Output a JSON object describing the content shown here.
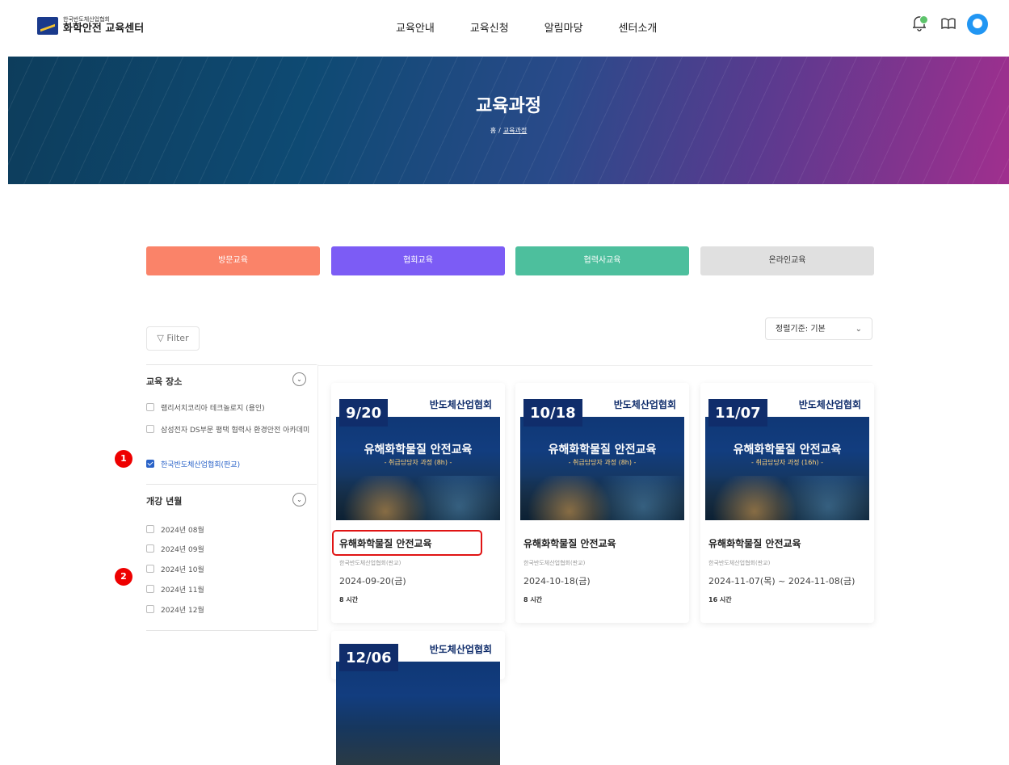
{
  "header": {
    "logo_small": "한국반도체산업협회",
    "logo_big": "화학안전 교육센터",
    "nav": [
      "교육안내",
      "교육신청",
      "알림마당",
      "센터소개"
    ]
  },
  "banner": {
    "title": "교육과정",
    "crumb_home": "홈",
    "crumb_current": "교육과정"
  },
  "categories": [
    {
      "label": "방문교육",
      "color": "#fa8369"
    },
    {
      "label": "협회교육",
      "color": "#7c5cf5"
    },
    {
      "label": "협력사교육",
      "color": "#4dbf9d"
    },
    {
      "label": "온라인교육",
      "color": "#e0e0e0"
    }
  ],
  "sort": {
    "label": "정렬기준:  기본"
  },
  "filter": {
    "label": "Filter"
  },
  "sidebar": {
    "location": {
      "title": "교육 장소",
      "options": [
        {
          "label": "램리서치코리아 테크놀로지 (용인)",
          "checked": false
        },
        {
          "label": "삼성전자 DS부문 평택 협력사 환경안전 아카데미",
          "checked": false
        },
        {
          "label": "한국반도체산업협회(판교)",
          "checked": true
        }
      ]
    },
    "month": {
      "title": "개강 년월",
      "options": [
        "2024년 08월",
        "2024년 09월",
        "2024년 10월",
        "2024년 11월",
        "2024년 12월"
      ]
    }
  },
  "badges": [
    "1",
    "2"
  ],
  "courses": [
    {
      "date_label": "9/20",
      "org": "반도체산업협회",
      "thumb_title": "유해화학물질 안전교육",
      "thumb_sub": "- 취급담당자 과정 (8h) -",
      "title": "유해화학물질 안전교육",
      "place": "한국반도체산업협회(판교)",
      "date": "2024-09-20(금)",
      "hours": "8 시간"
    },
    {
      "date_label": "10/18",
      "org": "반도체산업협회",
      "thumb_title": "유해화학물질 안전교육",
      "thumb_sub": "- 취급담당자 과정 (8h) -",
      "title": "유해화학물질 안전교육",
      "place": "한국반도체산업협회(판교)",
      "date": "2024-10-18(금)",
      "hours": "8 시간"
    },
    {
      "date_label": "11/07",
      "org": "반도체산업협회",
      "thumb_title": "유해화학물질 안전교육",
      "thumb_sub": "- 취급담당자 과정 (16h) -",
      "title": "유해화학물질 안전교육",
      "place": "한국반도체산업협회(판교)",
      "date": "2024-11-07(목) ~ 2024-11-08(금)",
      "hours": "16 시간"
    },
    {
      "date_label": "12/06",
      "org": "반도체산업협회"
    }
  ]
}
